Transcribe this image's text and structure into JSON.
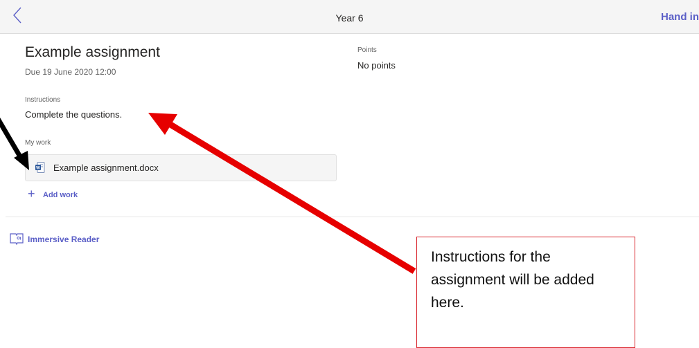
{
  "header": {
    "title": "Year 6",
    "hand_in_label": "Hand in"
  },
  "assignment": {
    "title": "Example assignment",
    "due": "Due 19 June 2020 12:00",
    "instructions_label": "Instructions",
    "instructions_text": "Complete the questions.",
    "points_label": "Points",
    "points_value": "No points"
  },
  "my_work": {
    "label": "My work",
    "files": [
      {
        "name": "Example assignment.docx",
        "icon": "word-doc-icon"
      }
    ],
    "add_work_label": "Add work"
  },
  "immersive_reader": {
    "label": "Immersive Reader",
    "icon": "immersive-reader-icon"
  },
  "annotation": {
    "callout_text": "Instructions for the assignment will be added here."
  },
  "colors": {
    "accent": "#5b5fc7",
    "annotation_red": "#e60000",
    "annotation_black": "#000000"
  }
}
